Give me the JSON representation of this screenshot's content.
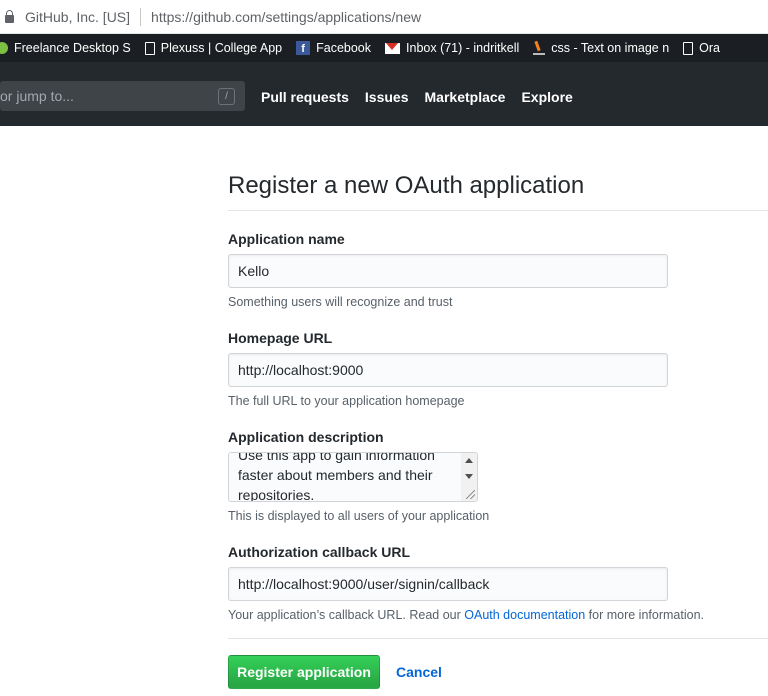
{
  "browser": {
    "site_identity": "GitHub, Inc. [US]",
    "url": "https://github.com/settings/applications/new"
  },
  "bookmarks": [
    {
      "label": "Freelance Desktop S",
      "icon": "green-circle-icon"
    },
    {
      "label": "Plexuss | College App",
      "icon": "page-icon"
    },
    {
      "label": "Facebook",
      "icon": "facebook-icon"
    },
    {
      "label": "Inbox (71) - indritkell",
      "icon": "gmail-icon"
    },
    {
      "label": "css - Text on image n",
      "icon": "stackoverflow-icon"
    },
    {
      "label": "Ora",
      "icon": "page-icon"
    }
  ],
  "header": {
    "search_placeholder": "or jump to...",
    "search_shortcut": "/",
    "nav": [
      "Pull requests",
      "Issues",
      "Marketplace",
      "Explore"
    ]
  },
  "form": {
    "title": "Register a new OAuth application",
    "app_name": {
      "label": "Application name",
      "value": "Kello",
      "note": "Something users will recognize and trust"
    },
    "homepage": {
      "label": "Homepage URL",
      "value": "http://localhost:9000",
      "note": "The full URL to your application homepage"
    },
    "description": {
      "label": "Application description",
      "value": "Use this app to gain information faster about members and their repositories.",
      "note": "This is displayed to all users of your application"
    },
    "callback": {
      "label": "Authorization callback URL",
      "value": "http://localhost:9000/user/signin/callback",
      "note_before": "Your application’s callback URL. Read our",
      "note_link": "OAuth documentation",
      "note_after": "for more information."
    },
    "submit_label": "Register application",
    "cancel_label": "Cancel"
  },
  "colors": {
    "header_bg": "#24292e",
    "primary_button": "#28a745",
    "link": "#0366d6"
  }
}
